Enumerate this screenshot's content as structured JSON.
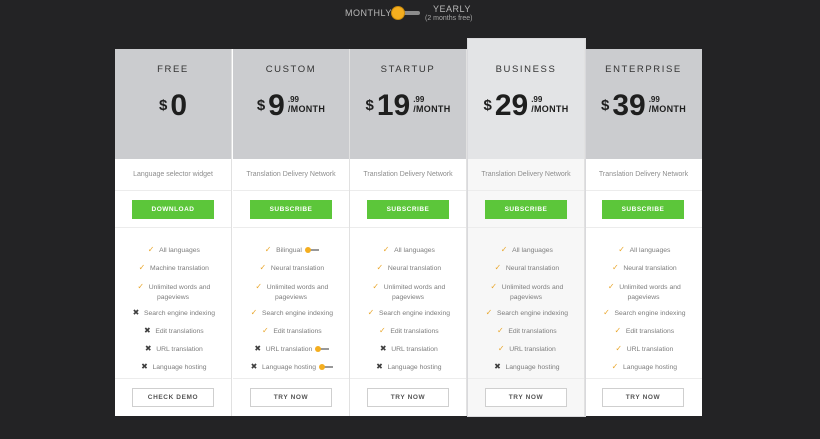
{
  "billing": {
    "monthly_label": "MONTHLY",
    "yearly_label": "YEARLY",
    "yearly_note": "(2 months free)"
  },
  "colors": {
    "accent": "#f4ae1f",
    "cta": "#5cc63a",
    "header": "#cbcccf",
    "header_featured": "#e3e4e6",
    "background": "#232325"
  },
  "plans": [
    {
      "name": "FREE",
      "currency": "$",
      "amount": "0",
      "cents": "",
      "period": "",
      "subtitle": "Language selector widget",
      "cta": "DOWNLOAD",
      "secondary": "CHECK DEMO",
      "features": [
        {
          "text": "All languages",
          "mark": "check"
        },
        {
          "text": "Machine translation",
          "mark": "check"
        },
        {
          "text": "Unlimited words and pageviews",
          "mark": "check"
        },
        {
          "text": "Search engine indexing",
          "mark": "cross"
        },
        {
          "text": "Edit translations",
          "mark": "cross"
        },
        {
          "text": "URL translation",
          "mark": "cross"
        },
        {
          "text": "Language hosting",
          "mark": "cross"
        }
      ]
    },
    {
      "name": "CUSTOM",
      "currency": "$",
      "amount": "9",
      "cents": ".99",
      "period": "/MONTH",
      "subtitle": "Translation Delivery Network",
      "cta": "SUBSCRIBE",
      "secondary": "TRY NOW",
      "features": [
        {
          "text": "Bilingual",
          "mark": "check",
          "toggle": true
        },
        {
          "text": "Neural translation",
          "mark": "check"
        },
        {
          "text": "Unlimited words and pageviews",
          "mark": "check"
        },
        {
          "text": "Search engine indexing",
          "mark": "check"
        },
        {
          "text": "Edit translations",
          "mark": "check"
        },
        {
          "text": "URL translation",
          "mark": "cross",
          "toggle": true
        },
        {
          "text": "Language hosting",
          "mark": "cross",
          "toggle": true
        }
      ]
    },
    {
      "name": "STARTUP",
      "currency": "$",
      "amount": "19",
      "cents": ".99",
      "period": "/MONTH",
      "subtitle": "Translation Delivery Network",
      "cta": "SUBSCRIBE",
      "secondary": "TRY NOW",
      "features": [
        {
          "text": "All languages",
          "mark": "check"
        },
        {
          "text": "Neural translation",
          "mark": "check"
        },
        {
          "text": "Unlimited words and pageviews",
          "mark": "check"
        },
        {
          "text": "Search engine indexing",
          "mark": "check"
        },
        {
          "text": "Edit translations",
          "mark": "check"
        },
        {
          "text": "URL translation",
          "mark": "cross"
        },
        {
          "text": "Language hosting",
          "mark": "cross"
        }
      ]
    },
    {
      "name": "BUSINESS",
      "currency": "$",
      "amount": "29",
      "cents": ".99",
      "period": "/MONTH",
      "subtitle": "Translation Delivery Network",
      "cta": "SUBSCRIBE",
      "secondary": "TRY NOW",
      "featured": true,
      "features": [
        {
          "text": "All languages",
          "mark": "check"
        },
        {
          "text": "Neural translation",
          "mark": "check"
        },
        {
          "text": "Unlimited words and pageviews",
          "mark": "check"
        },
        {
          "text": "Search engine indexing",
          "mark": "check"
        },
        {
          "text": "Edit translations",
          "mark": "check"
        },
        {
          "text": "URL translation",
          "mark": "check"
        },
        {
          "text": "Language hosting",
          "mark": "cross"
        }
      ]
    },
    {
      "name": "ENTERPRISE",
      "currency": "$",
      "amount": "39",
      "cents": ".99",
      "period": "/MONTH",
      "subtitle": "Translation Delivery Network",
      "cta": "SUBSCRIBE",
      "secondary": "TRY NOW",
      "features": [
        {
          "text": "All languages",
          "mark": "check"
        },
        {
          "text": "Neural translation",
          "mark": "check"
        },
        {
          "text": "Unlimited words and pageviews",
          "mark": "check"
        },
        {
          "text": "Search engine indexing",
          "mark": "check"
        },
        {
          "text": "Edit translations",
          "mark": "check"
        },
        {
          "text": "URL translation",
          "mark": "check"
        },
        {
          "text": "Language hosting",
          "mark": "check"
        }
      ]
    }
  ]
}
